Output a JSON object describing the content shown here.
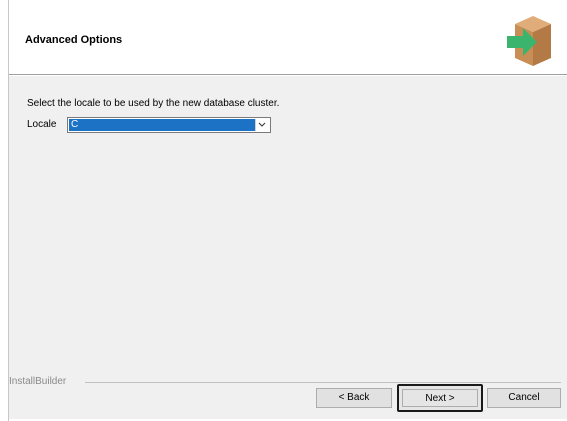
{
  "header": {
    "title": "Advanced Options",
    "icon": "package-arrow-icon"
  },
  "main": {
    "instruction": "Select the locale to be used by the new database cluster.",
    "locale_label": "Locale",
    "locale_value": "C"
  },
  "footer": {
    "brand": "InstallBuilder",
    "back_label": "< Back",
    "next_label": "Next >",
    "cancel_label": "Cancel"
  },
  "colors": {
    "selection": "#1c72c4",
    "box_brown": "#c98d56",
    "arrow_green": "#3bb56e"
  }
}
